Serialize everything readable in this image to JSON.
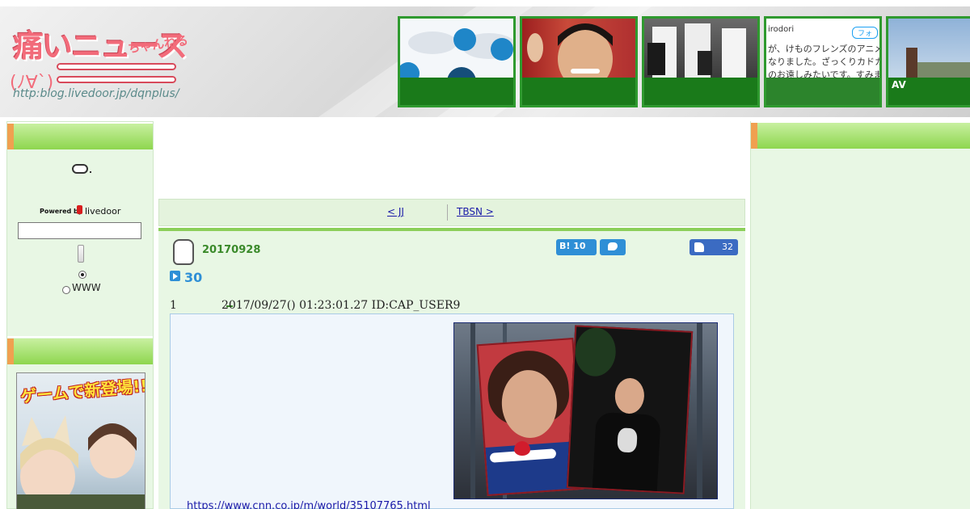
{
  "header": {
    "logo": {
      "main_text": "痛いニュース",
      "small_text": "ちゃんねる",
      "face_text": "(ﾉ∀`)",
      "url_text": "http:blog.livedoor.jp/dqnplus/"
    },
    "thumbnails": [
      {
        "label": "",
        "brand": "",
        "text": "",
        "follow": ""
      },
      {
        "label": "",
        "brand": "",
        "text": "",
        "follow": ""
      },
      {
        "label": "",
        "brand": "",
        "text": "",
        "follow": ""
      },
      {
        "label": "",
        "brand": "irodori",
        "text": "が、けものフレンズのアニメ\nなりました。ざっくりカドカ\nのお遠しみたいです。すみま",
        "follow": "フォ"
      },
      {
        "label": "AV",
        "brand": "",
        "text": "",
        "follow": ""
      }
    ]
  },
  "sidebar_left": {
    "powered_by": "Powered by",
    "livedoor": "livedoor",
    "search_value": "",
    "radio_www_label": "WWW",
    "banner_text": "ゲームで新登場!!"
  },
  "nav": {
    "prev_label": "< JJ",
    "next_label": "TBSN >"
  },
  "article": {
    "date": "20170928",
    "hatena_count": "B! 10",
    "like_count": "32",
    "title": "30",
    "res_number": "1",
    "res_meta": "2017/09/27() 01:23:01.27 ID:CAP_USER9",
    "link_text": "https://www.cnn.co.jp/m/world/35107765.html"
  },
  "colors": {
    "sidebar_green": "#e8f7e4",
    "header_green": "#8ed64e",
    "accent_orange": "#f0a050",
    "link_blue": "#1a1aa8",
    "title_blue": "#2e8fd6"
  }
}
